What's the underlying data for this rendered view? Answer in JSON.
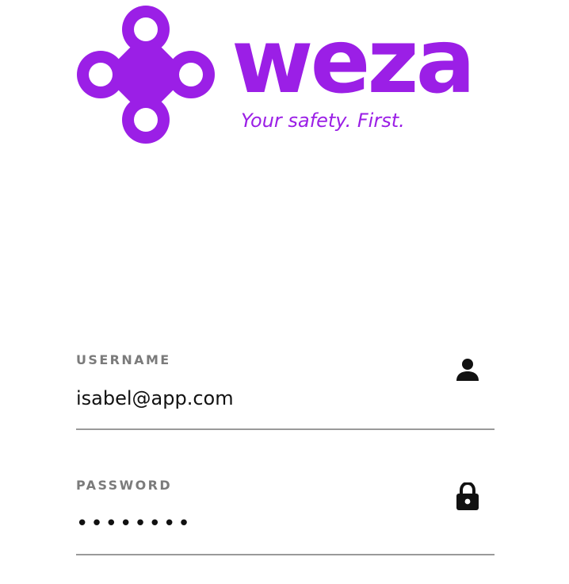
{
  "brand": {
    "logo_icon": "weza-petal-logo-icon",
    "wordmark": "weza",
    "tagline": "Your safety. First.",
    "accent_color": "#9b1fe6"
  },
  "login_form": {
    "username": {
      "label": "USERNAME",
      "value": "isabel@app.com",
      "icon": "person-icon"
    },
    "password": {
      "label": "PASSWORD",
      "value": "••••••••",
      "icon": "lock-icon"
    }
  }
}
